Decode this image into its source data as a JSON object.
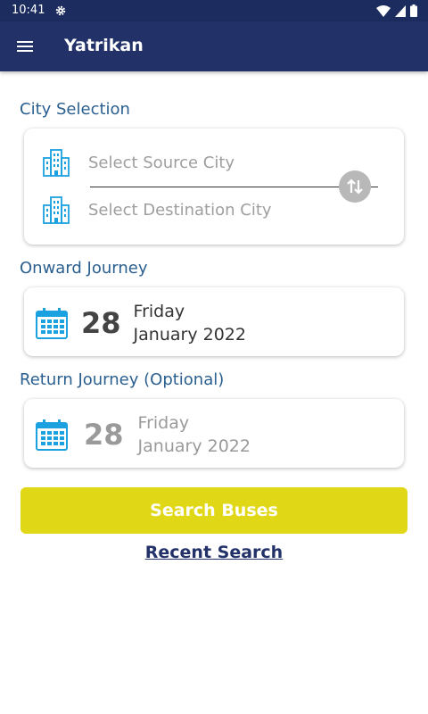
{
  "status_bar": {
    "time": "10:41"
  },
  "app_bar": {
    "title": "Yatrikan"
  },
  "city_selection": {
    "label": "City Selection",
    "source_placeholder": "Select Source City",
    "destination_placeholder": "Select Destination City"
  },
  "onward": {
    "label": "Onward Journey",
    "day": "28",
    "weekday": "Friday",
    "month_year": "January 2022"
  },
  "return": {
    "label": "Return Journey (Optional)",
    "day": "28",
    "weekday": "Friday",
    "month_year": "January 2022"
  },
  "actions": {
    "search_label": "Search Buses",
    "recent_label": "Recent Search"
  },
  "colors": {
    "appbar": "#223168",
    "accent_text": "#2a5f8f",
    "icon_blue": "#1ba0e0",
    "search_button": "#e0d816"
  }
}
